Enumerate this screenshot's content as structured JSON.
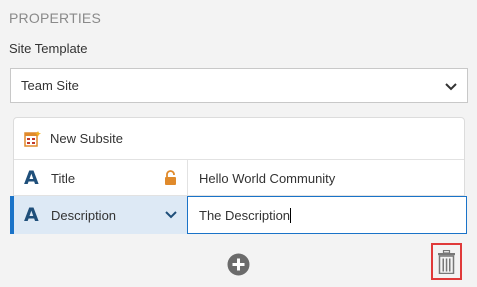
{
  "properties": {
    "header": "PROPERTIES",
    "site_template": {
      "label": "Site Template",
      "selected": "Team Site"
    }
  },
  "card": {
    "header_label": "New Subsite",
    "header_icon": "new-subsite-icon",
    "rows": [
      {
        "type_icon": "A",
        "label": "Title",
        "value": "Hello World Community",
        "locked": true
      },
      {
        "type_icon": "A",
        "label": "Description",
        "value": "The Description",
        "selected": true
      }
    ]
  },
  "actions": {
    "add_icon": "plus-circle-icon",
    "delete_icon": "trash-icon"
  },
  "colors": {
    "background": "#f3f3f3",
    "accent": "#1a73c8",
    "type_icon": "#1f4f7a",
    "lock": "#e08a2b",
    "delete_highlight": "#e03a3a"
  }
}
